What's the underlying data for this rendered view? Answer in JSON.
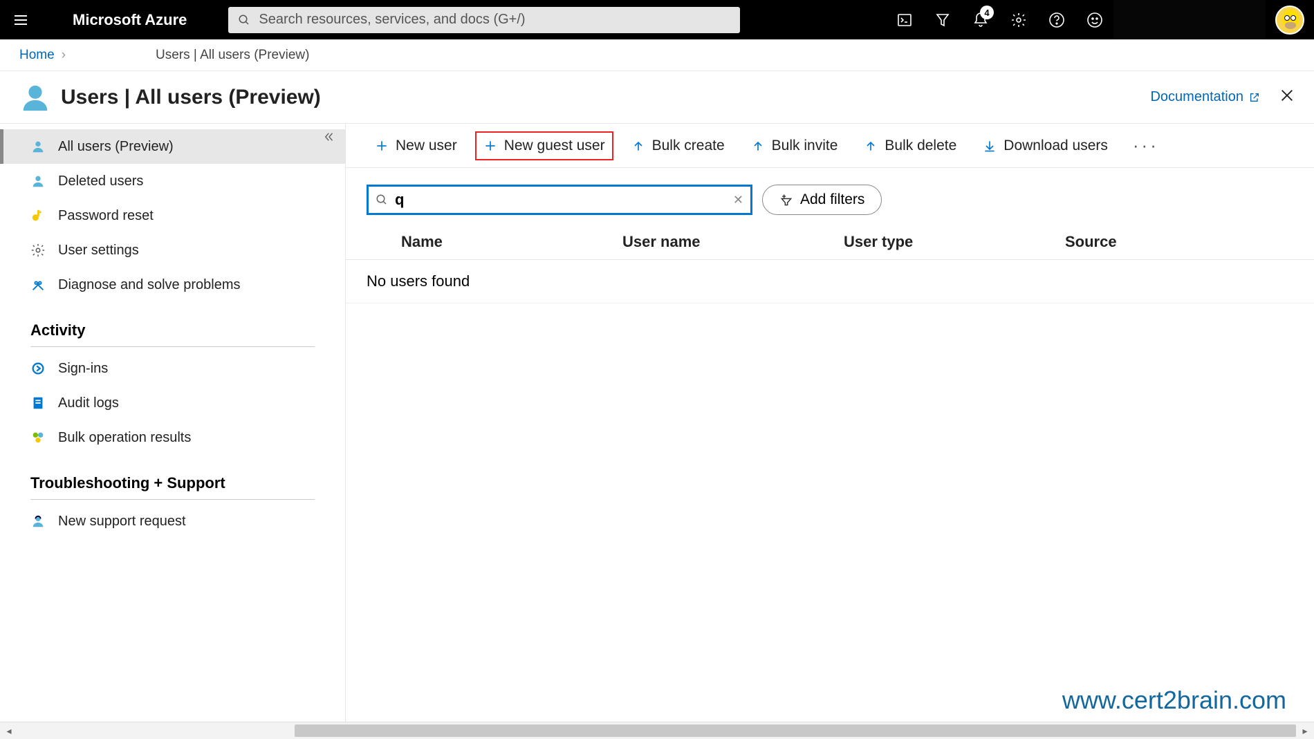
{
  "topbar": {
    "brand": "Microsoft Azure",
    "search_placeholder": "Search resources, services, and docs (G+/)",
    "notification_count": "4"
  },
  "breadcrumb": {
    "home": "Home",
    "current": "Users | All users (Preview)"
  },
  "title": {
    "text": "Users | All users (Preview)",
    "doc_link": "Documentation"
  },
  "sidebar": {
    "items": [
      {
        "label": "All users (Preview)"
      },
      {
        "label": "Deleted users"
      },
      {
        "label": "Password reset"
      },
      {
        "label": "User settings"
      },
      {
        "label": "Diagnose and solve problems"
      }
    ],
    "section_activity": "Activity",
    "activity_items": [
      {
        "label": "Sign-ins"
      },
      {
        "label": "Audit logs"
      },
      {
        "label": "Bulk operation results"
      }
    ],
    "section_support": "Troubleshooting + Support",
    "support_items": [
      {
        "label": "New support request"
      }
    ]
  },
  "toolbar": {
    "new_user": "New user",
    "new_guest": "New guest user",
    "bulk_create": "Bulk create",
    "bulk_invite": "Bulk invite",
    "bulk_delete": "Bulk delete",
    "download": "Download users"
  },
  "filters": {
    "search_value": "q",
    "add_filters": "Add filters"
  },
  "table": {
    "columns": [
      "Name",
      "User name",
      "User type",
      "Source"
    ],
    "empty": "No users found"
  },
  "watermark": "www.cert2brain.com"
}
